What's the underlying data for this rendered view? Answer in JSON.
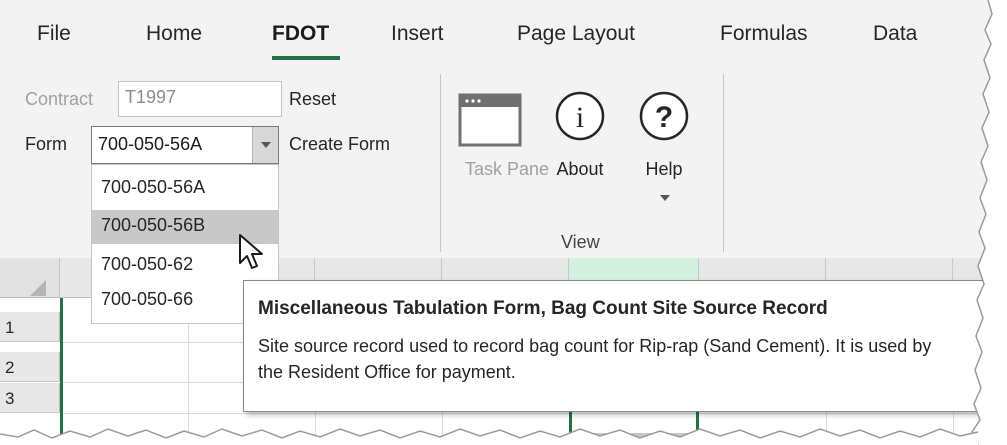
{
  "tabs": [
    "File",
    "Home",
    "FDOT",
    "Insert",
    "Page Layout",
    "Formulas",
    "Data"
  ],
  "ribbon": {
    "contract_label": "Contract",
    "contract_value": "T1997",
    "reset_label": "Reset",
    "form_label": "Form",
    "form_value": "700-050-56A",
    "create_form_label": "Create Form",
    "task_pane_label": "Task Pane",
    "about_label": "About",
    "help_label": "Help",
    "view_group_label": "View"
  },
  "dropdown": {
    "options": [
      "700-050-56A",
      "700-050-56B",
      "700-050-62",
      "700-050-66"
    ],
    "highlighted": "700-050-56B"
  },
  "sheet": {
    "rows": [
      "1",
      "2",
      "3"
    ]
  },
  "tooltip": {
    "title": "Miscellaneous Tabulation Form, Bag Count Site Source Record",
    "body": "Site source record used to record bag count for Rip-rap (Sand Cement). It is used by the Resident Office for payment."
  },
  "colors": {
    "excel_green": "#217346",
    "ribbon_bg": "#f3f3f3",
    "selected_item": "#c8c8c8"
  }
}
